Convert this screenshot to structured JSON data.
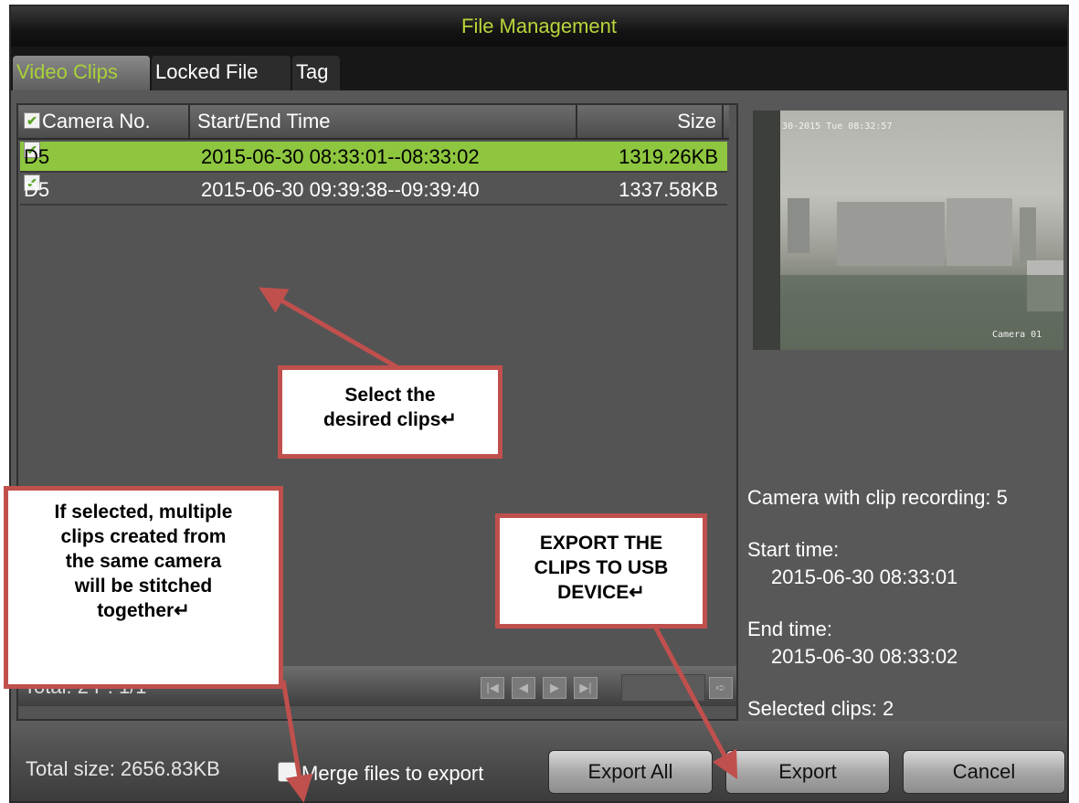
{
  "window": {
    "title": "File Management",
    "tabs": [
      "Video Clips",
      "Locked File",
      "Tag"
    ],
    "active_tab": "Video Clips"
  },
  "list": {
    "columns": {
      "camera": "Camera No.",
      "time": "Start/End Time",
      "size": "Size"
    },
    "rows": [
      {
        "camera": "D5",
        "time": "2015-06-30 08:33:01--08:33:02",
        "size": "1319.26KB",
        "checked": true,
        "selected": true
      },
      {
        "camera": "D5",
        "time": "2015-06-30 09:39:38--09:39:40",
        "size": "1337.58KB",
        "checked": true,
        "selected": false
      }
    ],
    "footer_text": "Total: 2  P: 1/1"
  },
  "preview": {
    "osd_datetime": "08-30-2015 Tue 08:32:57",
    "osd_camera": "Camera 01"
  },
  "info": {
    "camera_line": "Camera with clip recording: 5",
    "start_label": "Start time:",
    "start_value": "2015-06-30 08:33:01",
    "end_label": "End time:",
    "end_value": "2015-06-30 08:33:02",
    "selected_line": "Selected clips: 2"
  },
  "bottom": {
    "total_size": "Total size: 2656.83KB",
    "merge_label": "Merge files to export",
    "merge_checked": false,
    "export_all": "Export All",
    "export": "Export",
    "cancel": "Cancel"
  },
  "callouts": {
    "select": [
      "Select the",
      "desired clips↵"
    ],
    "merge": [
      "If selected, multiple",
      "clips created from",
      "the same camera",
      "will be stitched",
      "together↵"
    ],
    "export": [
      "EXPORT THE",
      "CLIPS TO USB",
      "DEVICE↵"
    ]
  },
  "colors": {
    "accent_green": "#8ec63f",
    "title_green": "#b9d63a",
    "callout_red": "#c0504d"
  }
}
